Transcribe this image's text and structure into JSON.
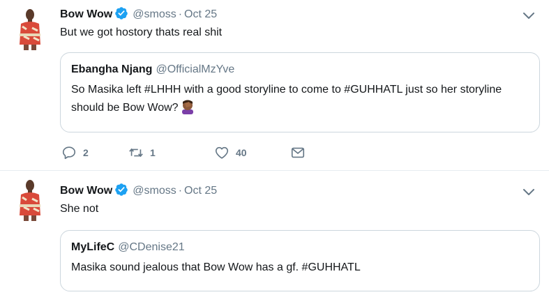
{
  "tweets": [
    {
      "name": "Bow Wow",
      "handle": "@smoss",
      "separator": "·",
      "date": "Oct 25",
      "text": "But we got hostory thats real shit",
      "quote": {
        "name": "Ebangha Njang",
        "handle": "@OfficialMzYve",
        "text": "So Masika left #LHHH with a good storyline to come to #GUHHATL just so her storyline should be Bow Wow?",
        "emoji": "facepalm-emoji"
      },
      "actions": {
        "replies": "2",
        "retweets": "1",
        "likes": "40"
      }
    },
    {
      "name": "Bow Wow",
      "handle": "@smoss",
      "separator": "·",
      "date": "Oct 25",
      "text": "She not",
      "quote": {
        "name": "MyLifeC",
        "handle": "@CDenise21",
        "text": "Masika sound jealous that Bow Wow has a gf. #GUHHATL"
      }
    }
  ],
  "colors": {
    "accent": "#1da1f2",
    "muted": "#657786",
    "border": "#ccd6dd"
  }
}
